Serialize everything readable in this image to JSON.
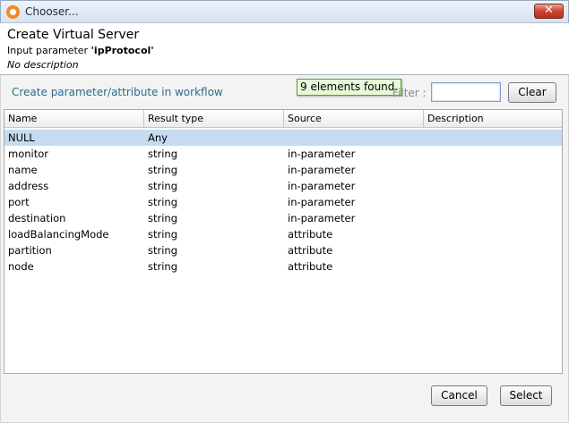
{
  "window": {
    "title": "Chooser...",
    "close_symbol": "✕"
  },
  "header": {
    "title": "Create Virtual Server",
    "param_prefix": "Input parameter",
    "param_name": "'ipProtocol'",
    "description": "No description"
  },
  "toolbar": {
    "create_link": "Create parameter/attribute in workflow",
    "tooltip": "9 elements found.",
    "filter_label": "Filter :",
    "filter_value": "",
    "clear_label": "Clear"
  },
  "table": {
    "columns": [
      "Name",
      "Result type",
      "Source",
      "Description"
    ],
    "rows": [
      [
        "NULL",
        "Any",
        "",
        ""
      ],
      [
        "monitor",
        "string",
        "in-parameter",
        ""
      ],
      [
        "name",
        "string",
        "in-parameter",
        ""
      ],
      [
        "address",
        "string",
        "in-parameter",
        ""
      ],
      [
        "port",
        "string",
        "in-parameter",
        ""
      ],
      [
        "destination",
        "string",
        "in-parameter",
        ""
      ],
      [
        "loadBalancingMode",
        "string",
        "attribute",
        ""
      ],
      [
        "partition",
        "string",
        "attribute",
        ""
      ],
      [
        "node",
        "string",
        "attribute",
        ""
      ]
    ],
    "selected_index": 0
  },
  "footer": {
    "cancel_label": "Cancel",
    "select_label": "Select"
  },
  "colors": {
    "selection": "#c6dbf0",
    "link": "#2e6b8a",
    "tooltip_bg": "#e7f9d9"
  }
}
